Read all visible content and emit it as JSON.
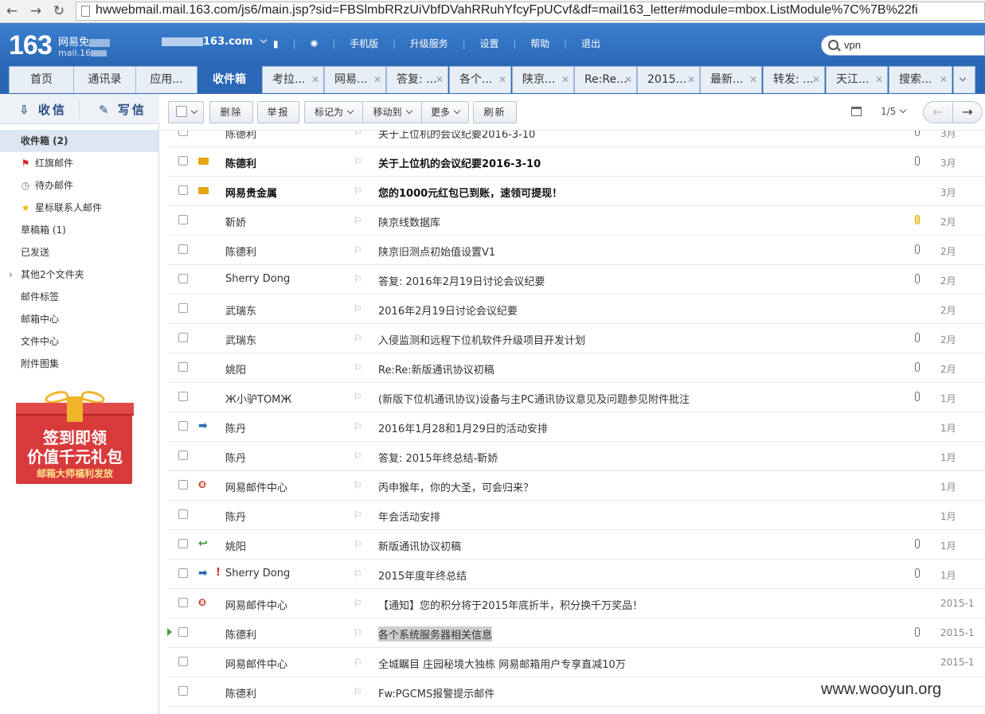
{
  "browser": {
    "back": "←",
    "forward": "→",
    "reload": "↻",
    "url": "hwwebmail.mail.163.com/js6/main.jsp?sid=FBSlmbRRzUiVbfDVahRRuhYfcyFpUCvf&df=mail163_letter#module=mbox.ListModule%7C%7B%22fi"
  },
  "header": {
    "logo": "163",
    "logo_sub1": "网易免",
    "logo_sub2": "mail.16",
    "account_suffix": "163.com",
    "links": [
      "手机版",
      "升级服务",
      "设置",
      "帮助",
      "退出"
    ],
    "search_value": "vpn"
  },
  "tabs": [
    {
      "label": "首页"
    },
    {
      "label": "通讯录"
    },
    {
      "label": "应用..."
    },
    {
      "label": "收件箱"
    },
    {
      "label": "考拉..."
    },
    {
      "label": "网易..."
    },
    {
      "label": "答复: ..."
    },
    {
      "label": "各个..."
    },
    {
      "label": "陕京..."
    },
    {
      "label": "Re:Re..."
    },
    {
      "label": "2015..."
    },
    {
      "label": "最新..."
    },
    {
      "label": "转发: ..."
    },
    {
      "label": "天江..."
    },
    {
      "label": "搜索..."
    }
  ],
  "sidebar": {
    "receive": "收信",
    "compose": "写信",
    "folders": [
      {
        "label": "收件箱 (2)"
      },
      {
        "label": "红旗邮件"
      },
      {
        "label": "待办邮件"
      },
      {
        "label": "星标联系人邮件"
      },
      {
        "label": "草稿箱 (1)"
      },
      {
        "label": "已发送"
      },
      {
        "label": "其他2个文件夹"
      },
      {
        "label": "邮件标签"
      },
      {
        "label": "邮箱中心"
      },
      {
        "label": "文件中心"
      },
      {
        "label": "附件图集"
      }
    ],
    "promo": {
      "line1": "签到即领",
      "line2": "价值千元礼包",
      "line3": "邮箱大师福利发放"
    }
  },
  "toolbar": {
    "delete": "删除",
    "report": "举报",
    "mark_as": "标记为",
    "move_to": "移动到",
    "more": "更多",
    "refresh": "刷新",
    "pager": "1/5"
  },
  "mails": [
    {
      "sender": "陈德利",
      "subject": "关于上位机的会议纪要2016-3-10",
      "date": "3月",
      "bold": false,
      "status": "",
      "attach": true
    },
    {
      "sender": "陈德利",
      "subject": "关于上位机的会议纪要2016-3-10",
      "date": "3月",
      "bold": true,
      "status": "unread",
      "attach": true
    },
    {
      "sender": "网易贵金属",
      "subject": "您的1000元红包已到账，速领可提现！",
      "date": "3月",
      "bold": true,
      "status": "unread",
      "attach": false
    },
    {
      "sender": "靳娇",
      "subject": "陕京线数据库",
      "date": "2月",
      "bold": false,
      "status": "",
      "attach": true,
      "attach_color": "yellow"
    },
    {
      "sender": "陈德利",
      "subject": "陕京旧测点初始值设置V1",
      "date": "2月",
      "bold": false,
      "status": "",
      "attach": true
    },
    {
      "sender": "Sherry Dong",
      "subject": "答复: 2016年2月19日讨论会议纪要",
      "date": "2月",
      "bold": false,
      "status": "",
      "attach": true
    },
    {
      "sender": "武瑞东",
      "subject": "2016年2月19日讨论会议纪要",
      "date": "2月",
      "bold": false,
      "status": "",
      "attach": false
    },
    {
      "sender": "武瑞东",
      "subject": "入侵监测和远程下位机软件升级项目开发计划",
      "date": "2月",
      "bold": false,
      "status": "",
      "attach": true
    },
    {
      "sender": "姚阳",
      "subject": "Re:Re:新版通讯协议初稿",
      "date": "2月",
      "bold": false,
      "status": "",
      "attach": true
    },
    {
      "sender": "Ж小驴TOMЖ",
      "subject": "(新版下位机通讯协议)设备与主PC通讯协议意见及问题参见附件批注",
      "date": "1月",
      "bold": false,
      "status": "",
      "attach": true
    },
    {
      "sender": "陈丹",
      "subject": "2016年1月28和1月29日的活动安排",
      "date": "1月",
      "bold": false,
      "status": "forward",
      "attach": false
    },
    {
      "sender": "陈丹",
      "subject": "答复: 2015年终总结-靳娇",
      "date": "1月",
      "bold": false,
      "status": "",
      "attach": false
    },
    {
      "sender": "网易邮件中心",
      "subject": "丙申猴年，你的大圣，可会归来？",
      "date": "1月",
      "bold": false,
      "status": "system",
      "attach": false
    },
    {
      "sender": "陈丹",
      "subject": "年会活动安排",
      "date": "1月",
      "bold": false,
      "status": "",
      "attach": false
    },
    {
      "sender": "姚阳",
      "subject": "新版通讯协议初稿",
      "date": "1月",
      "bold": false,
      "status": "reply",
      "attach": true
    },
    {
      "sender": "Sherry Dong",
      "subject": "2015年度年终总结",
      "date": "1月",
      "bold": false,
      "status": "forward",
      "attach": true,
      "urgent": "!"
    },
    {
      "sender": "网易邮件中心",
      "subject": "【通知】您的积分将于2015年底折半，积分换千万奖品！",
      "date": "2015-1",
      "bold": false,
      "status": "system",
      "attach": false
    },
    {
      "sender": "陈德利",
      "subject": "各个系统服务器相关信息",
      "date": "2015-1",
      "bold": false,
      "status": "",
      "attach": true,
      "current": true,
      "highlight": true
    },
    {
      "sender": "网易邮件中心",
      "subject": "全城瞩目 庄园秘境大独栋 网易邮箱用户专享直减10万",
      "date": "2015-1",
      "bold": false,
      "status": "",
      "attach": false
    },
    {
      "sender": "陈德利",
      "subject": "Fw:PGCMS报警提示邮件",
      "date": "",
      "bold": false,
      "status": "",
      "attach": false
    }
  ],
  "watermark": "www.wooyun.org"
}
